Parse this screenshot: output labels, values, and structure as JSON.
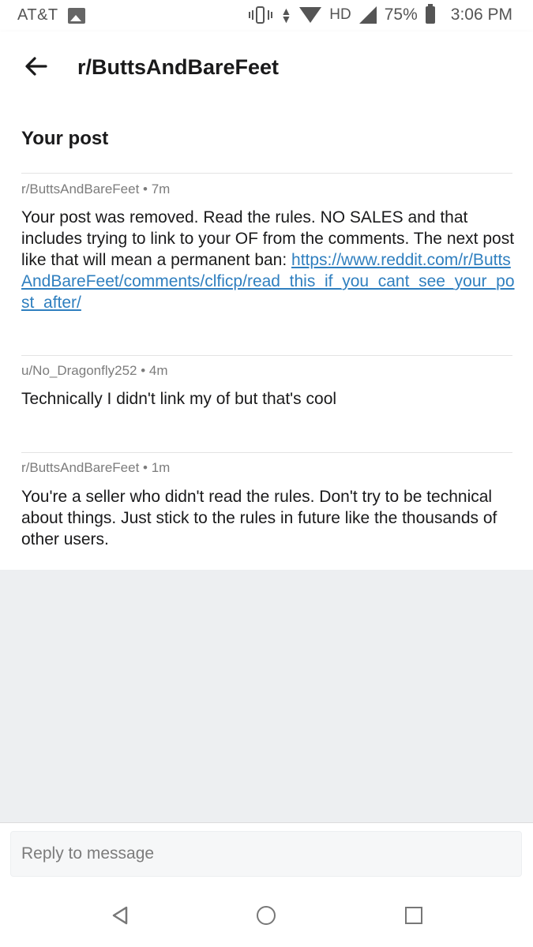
{
  "status_bar": {
    "carrier": "AT&T",
    "network": "HD",
    "battery": "75%",
    "time": "3:06 PM",
    "icons": [
      "image-icon",
      "vibrate-icon",
      "data-arrows-icon",
      "wifi-icon",
      "signal-icon",
      "battery-icon"
    ]
  },
  "header": {
    "back_icon": "arrow-left-icon",
    "title": "r/ButtsAndBareFeet"
  },
  "thread": {
    "title": "Your post",
    "messages": [
      {
        "author": "r/ButtsAndBareFeet",
        "age": "7m",
        "text": "Your post was removed. Read the rules. NO SALES and that includes trying to link to your OF from the comments. The next post like that will mean a permanent ban: ",
        "link": "https://www.reddit.com/r/ButtsAndBareFeet/comments/clficp/read_this_if_you_cant_see_your_post_after/"
      },
      {
        "author": "u/No_Dragonfly252",
        "age": "4m",
        "text": "Technically I didn't link my of but that's cool"
      },
      {
        "author": "r/ButtsAndBareFeet",
        "age": "1m",
        "text": "You're a seller who didn't read the rules. Don't try to be technical about things. Just stick to the rules in future like the thousands of other users."
      }
    ]
  },
  "reply": {
    "placeholder": "Reply to message"
  },
  "nav": {
    "icons": [
      "nav-back-icon",
      "nav-home-icon",
      "nav-recents-icon"
    ]
  },
  "colors": {
    "link": "#2f7fbf",
    "meta": "#7c7c7c",
    "background_gray": "#edeff1"
  }
}
